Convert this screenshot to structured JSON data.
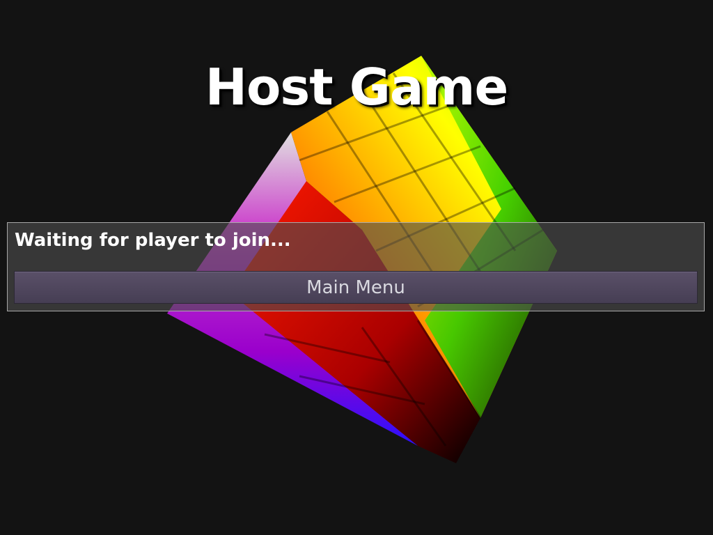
{
  "screen": {
    "title": "Host Game",
    "status_text": "Waiting for player to join...",
    "main_menu_label": "Main Menu"
  },
  "background_object": {
    "name": "rotating-color-cube",
    "colors": {
      "red": "#ff1a00",
      "orange": "#ff9900",
      "yellow": "#ffff00",
      "green": "#33cc00",
      "magenta": "#cc33cc",
      "blue": "#1a10ff",
      "white": "#eeeeee"
    }
  }
}
